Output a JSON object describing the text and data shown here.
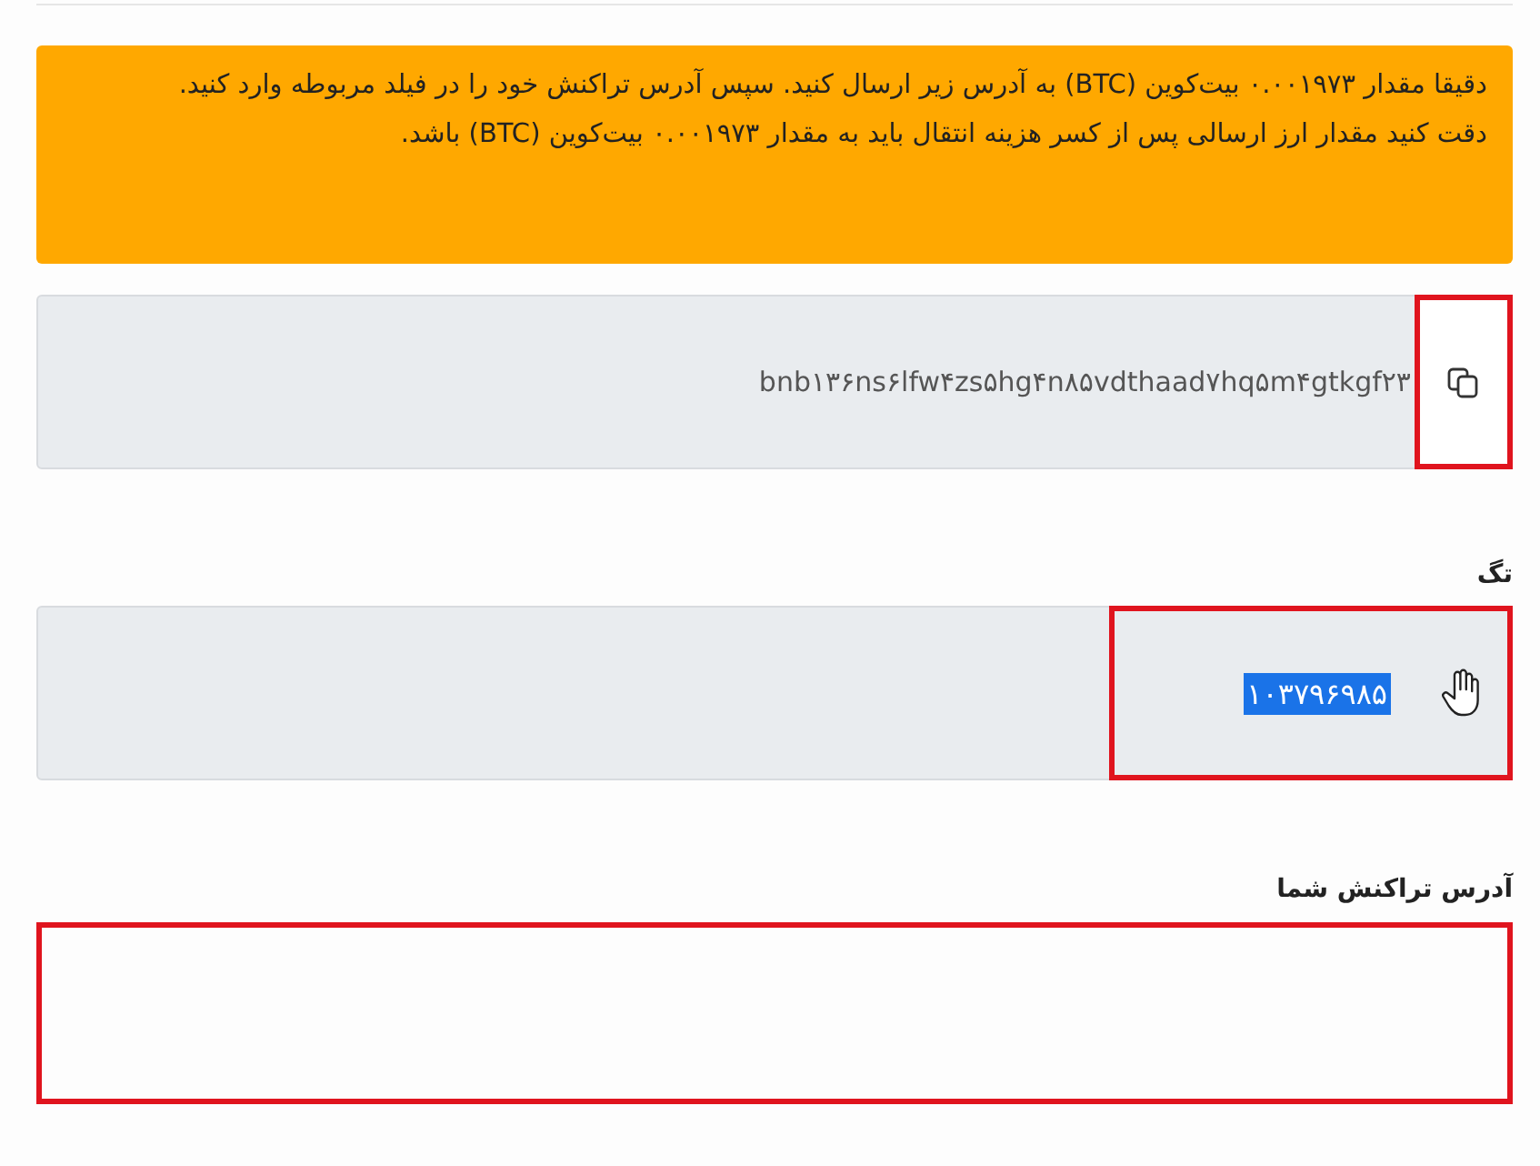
{
  "alert": {
    "lines": [
      "دقیقا مقدار ۰.۰۰۱۹۷۳ بیت‌کوین (BTC) به آدرس زیر ارسال کنید. سپس آدرس تراکنش خود را در فیلد مربوطه وارد کنید.",
      "دقت کنید مقدار ارز ارسالی پس از کسر هزینه انتقال باید به مقدار ۰.۰۰۱۹۷۳ بیت‌کوین (BTC) باشد."
    ]
  },
  "address": {
    "value": "bnb۱۳۶ns۶lfw۴zs۵hg۴n۸۵vdthaad۷hq۵m۴gtkgf۲۳",
    "copy_outlined": true
  },
  "tag": {
    "label": "تگ",
    "value": "۱۰۳۷۹۶۹۸۵",
    "value_highlighted": true,
    "outlined": true
  },
  "transaction": {
    "label": "آدرس تراکنش شما",
    "outlined": true
  }
}
